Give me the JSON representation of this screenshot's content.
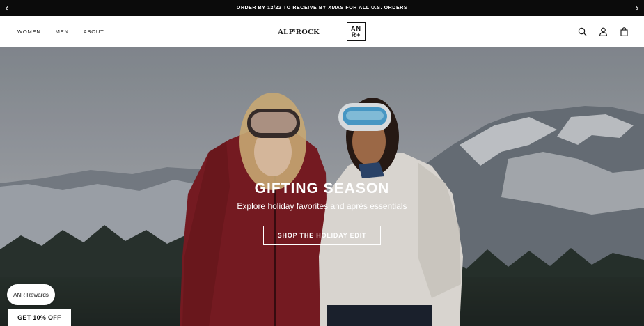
{
  "announcement": {
    "message": "ORDER BY 12/22 TO RECEIVE BY XMAS FOR ALL U.S. ORDERS",
    "prev_icon": "chevron-left-icon",
    "next_icon": "chevron-right-icon"
  },
  "header": {
    "nav": [
      "WOMEN",
      "MEN",
      "ABOUT"
    ],
    "logo_text": "ALPNROCK",
    "anr_plus_line1": "AN",
    "anr_plus_line2": "R+",
    "icons": [
      "search-icon",
      "account-icon",
      "bag-icon"
    ]
  },
  "hero": {
    "title": "GIFTING SEASON",
    "subtitle": "Explore holiday favorites and après essentials",
    "cta_label": "SHOP THE HOLIDAY EDIT"
  },
  "rewards": {
    "label": "ANR Rewards"
  },
  "discount": {
    "label": "GET 10% OFF"
  },
  "colors": {
    "announcement_bg": "#0b0b0b",
    "red_jacket": "#8a1f26",
    "white_jacket": "#ebe7e1"
  }
}
